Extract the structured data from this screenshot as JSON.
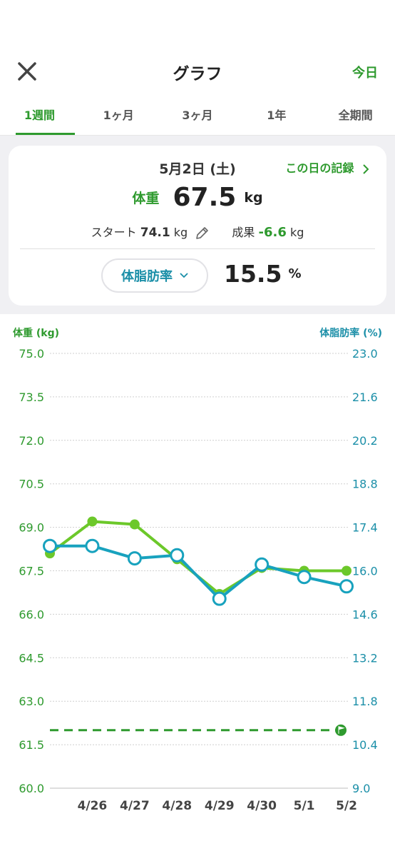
{
  "header": {
    "close_icon": "close-icon",
    "title": "グラフ",
    "today": "今日"
  },
  "tabs": [
    {
      "label": "1週間",
      "active": true
    },
    {
      "label": "1ヶ月",
      "active": false
    },
    {
      "label": "3ヶ月",
      "active": false
    },
    {
      "label": "1年",
      "active": false
    },
    {
      "label": "全期間",
      "active": false
    }
  ],
  "summary": {
    "date": "5月2日 (土)",
    "record_link": "この日の記録",
    "weight_label": "体重",
    "weight_value": "67.5",
    "weight_unit": "kg",
    "start_label": "スタート",
    "start_value": "74.1",
    "start_unit": "kg",
    "result_label": "成果",
    "result_value": "-6.6",
    "result_unit": "kg",
    "metric_selector": "体脂肪率",
    "metric_value": "15.5",
    "metric_unit": "%"
  },
  "colors": {
    "accent_green": "#2e9a2e",
    "weight_line": "#6cc82a",
    "fat_line": "#18a2be",
    "fat_text": "#1b8fa8",
    "goal_line": "#2e9a2e"
  },
  "chart_data": {
    "type": "line",
    "categories": [
      "4/26",
      "4/27",
      "4/28",
      "4/29",
      "4/30",
      "5/1",
      "5/2"
    ],
    "x_start_point": "4/25",
    "left_axis": {
      "label": "体重 (kg)",
      "ylim": [
        60.0,
        75.0
      ],
      "ticks": [
        "75.0",
        "73.5",
        "72.0",
        "70.5",
        "69.0",
        "67.5",
        "66.0",
        "64.5",
        "63.0",
        "61.5",
        "60.0"
      ]
    },
    "right_axis": {
      "label": "体脂肪率 (%)",
      "ylim": [
        9.0,
        23.0
      ],
      "ticks": [
        "23.0",
        "21.6",
        "20.2",
        "18.8",
        "17.4",
        "16.0",
        "14.6",
        "13.2",
        "11.8",
        "10.4",
        "9.0"
      ]
    },
    "series": [
      {
        "axis": "left",
        "x": [
          "4/25",
          "4/26",
          "4/27",
          "4/28",
          "4/29",
          "4/30",
          "5/1",
          "5/2"
        ],
        "values": [
          68.1,
          69.2,
          69.1,
          67.9,
          66.7,
          67.6,
          67.5,
          67.5
        ]
      },
      {
        "axis": "right",
        "x": [
          "4/25",
          "4/26",
          "4/27",
          "4/28",
          "4/29",
          "4/30",
          "5/1",
          "5/2"
        ],
        "values": [
          16.8,
          16.8,
          16.4,
          16.5,
          15.1,
          16.2,
          15.8,
          15.5
        ]
      }
    ],
    "goal_line": {
      "axis": "left",
      "value": 62.0,
      "icon": "flag-icon"
    },
    "grid": true
  }
}
